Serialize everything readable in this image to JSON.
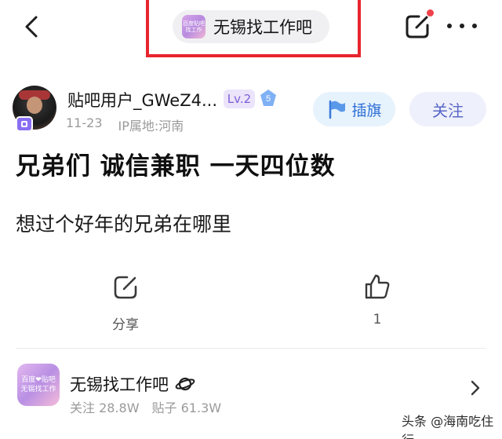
{
  "header": {
    "forum_name": "无锡找工作吧",
    "forum_logo_text": "百度贴吧 找工作",
    "icons": {
      "back": "back-arrow-icon",
      "edit": "edit-icon",
      "more": "more-icon"
    },
    "highlight_color": "#e8242e"
  },
  "author": {
    "name": "贴吧用户_GWeZ4...",
    "level": "Lv.2",
    "level_value": "5",
    "date": "11-23",
    "ip_location": "IP属地:河南",
    "flag_label": "插旗",
    "follow_label": "关注"
  },
  "post": {
    "title": "兄弟们 诚信兼职 一天四位数",
    "body": "想过个好年的兄弟在哪里"
  },
  "actions": {
    "share_label": "分享",
    "like_count": "1"
  },
  "forum_card": {
    "name": "无锡找工作吧",
    "logo_line1": "百度❤贴吧",
    "logo_line2": "无锡找工作",
    "followers": "关注 28.8W",
    "posts": "贴子 61.3W"
  },
  "watermark": "头条 @海南吃住行",
  "colors": {
    "accent_blue": "#2f6fd6",
    "follow_text": "#5a67c8",
    "notification": "#f0414a",
    "level_purple": "#7b5fd8"
  }
}
